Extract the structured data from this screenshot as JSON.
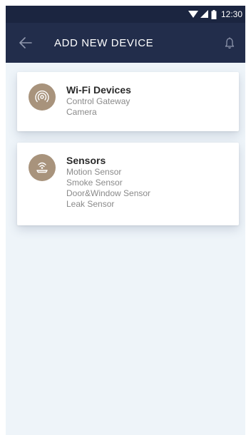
{
  "status_bar": {
    "time": "12:30"
  },
  "app_bar": {
    "title": "ADD NEW DEVICE"
  },
  "categories": [
    {
      "title": "Wi-Fi Devices",
      "icon": "wifi-signal-icon",
      "items": [
        "Control Gateway",
        "Camera"
      ]
    },
    {
      "title": "Sensors",
      "icon": "sensor-icon",
      "items": [
        "Motion Sensor",
        "Smoke Sensor",
        "Door&Window Sensor",
        "Leak Sensor"
      ]
    }
  ],
  "colors": {
    "status_bar_bg": "#1b2540",
    "app_bar_bg": "#222d4b",
    "page_bg": "#eef4f9",
    "icon_circle_bg": "#a8937c"
  }
}
